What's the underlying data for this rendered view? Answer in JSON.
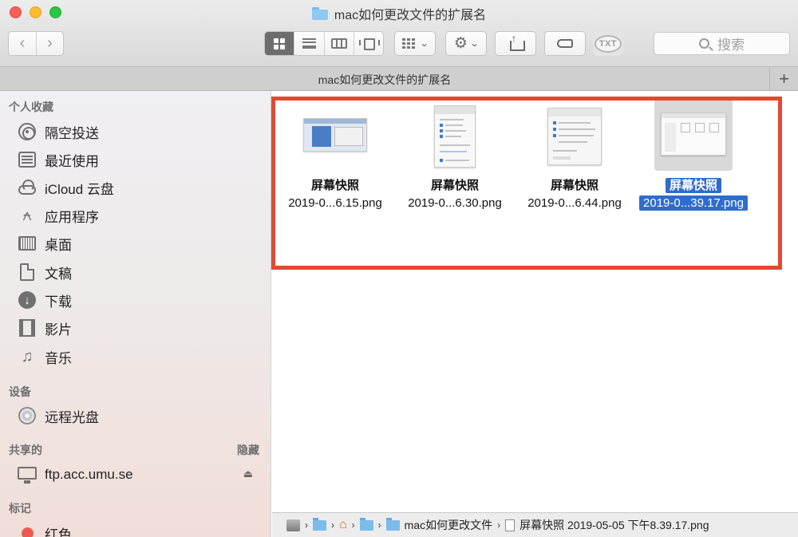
{
  "window": {
    "title": "mac如何更改文件的扩展名",
    "tab_title": "mac如何更改文件的扩展名"
  },
  "toolbar": {
    "back_label": "‹",
    "forward_label": "›",
    "txt_label": "TXT",
    "search_placeholder": "搜索",
    "view_modes": [
      "icon",
      "list",
      "column",
      "cover-flow"
    ],
    "active_view": "icon"
  },
  "sidebar": {
    "favorites_header": "个人收藏",
    "favorites": [
      {
        "label": "隔空投送",
        "icon": "airdrop-icon"
      },
      {
        "label": "最近使用",
        "icon": "recents-icon"
      },
      {
        "label": "iCloud 云盘",
        "icon": "icloud-icon"
      },
      {
        "label": "应用程序",
        "icon": "applications-icon"
      },
      {
        "label": "桌面",
        "icon": "desktop-icon"
      },
      {
        "label": "文稿",
        "icon": "documents-icon"
      },
      {
        "label": "下载",
        "icon": "downloads-icon"
      },
      {
        "label": "影片",
        "icon": "movies-icon"
      },
      {
        "label": "音乐",
        "icon": "music-icon"
      }
    ],
    "devices_header": "设备",
    "devices": [
      {
        "label": "远程光盘",
        "icon": "remote-disc-icon"
      }
    ],
    "shared_header": "共享的",
    "shared_hide": "隐藏",
    "shared": [
      {
        "label": "ftp.acc.umu.se",
        "icon": "server-icon"
      }
    ],
    "tags_header": "标记",
    "tags": [
      {
        "label": "红色",
        "color": "#ee5a52"
      }
    ]
  },
  "files": [
    {
      "name": "屏幕快照",
      "date": "2019-0...6.15.png",
      "selected": false
    },
    {
      "name": "屏幕快照",
      "date": "2019-0...6.30.png",
      "selected": false
    },
    {
      "name": "屏幕快照",
      "date": "2019-0...6.44.png",
      "selected": false
    },
    {
      "name": "屏幕快照",
      "date": "2019-0...39.17.png",
      "selected": true
    }
  ],
  "highlight_color": "#e04a33",
  "selection_color": "#2f6ccf",
  "pathbar": {
    "folder_label": "mac如何更改文件",
    "file_label": "屏幕快照 2019-05-05 下午8.39.17.png"
  }
}
